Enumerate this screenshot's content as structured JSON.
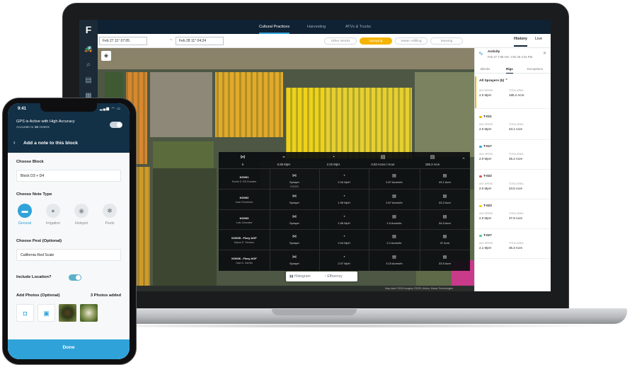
{
  "app": {
    "logo": "F",
    "tabs": [
      "Cultural Practices",
      "Harvesting",
      "ATVs & Trucks"
    ],
    "date_from": "Feb 27 11° 07:05",
    "date_to": "Feb 28 11° 04:24",
    "date_sep": "~",
    "filters": [
      "Other Works",
      "Spraying",
      "Water refilling",
      "Mowing"
    ],
    "view_tabs": [
      "History",
      "Live"
    ],
    "attribution": "Map data ©2023 Imagery ©2023, Airbus, Maxar Technologies",
    "chart_toggle": [
      "Histogram",
      "Efficiency"
    ]
  },
  "stats": {
    "summary": [
      "6",
      "5.85 MpH",
      "2.02 MpH",
      "0.83 Acres / Hour",
      "185.2 Acre"
    ],
    "rows": [
      {
        "name": "KG001",
        "owner": "Evelia S. RD Rosales",
        "equip": "Sprayer",
        "equip_id": "KG024",
        "speed": "2.04 MpH",
        "rate": "2.67 Acres/hr",
        "area": "43.1 Acre"
      },
      {
        "name": "KG002",
        "owner": "Juan Escobedo",
        "equip": "Sprayer",
        "equip_id": "",
        "speed": "1.96 MpH",
        "rate": "2.67 Acres/hr",
        "area": "33.2 Acre"
      },
      {
        "name": "KG003",
        "owner": "Luis Gonzalez",
        "equip": "Sprayer",
        "equip_id": "",
        "speed": "1.56 MpH",
        "rate": "1.5 Acres/hr",
        "area": "34.5 Acre"
      },
      {
        "name": "KG005 - Flory AOF",
        "owner": "Mauro E. Serrano",
        "equip": "Sprayer",
        "equip_id": "",
        "speed": "2.04 MpH",
        "rate": "2.2 Acres/hr",
        "area": "37 Acre"
      },
      {
        "name": "KG006 - Flory AOF",
        "owner": "Jose A. Carrillo",
        "equip": "Sprayer",
        "equip_id": "",
        "speed": "2.07 MpH",
        "rate": "3.15 Acres/hr",
        "area": "33.5 Acre"
      }
    ]
  },
  "panel": {
    "title": "Activity",
    "subtitle": "Feb 27 7:05 AM - Feb 28 4:24 PM",
    "tabs": [
      "Blocks",
      "Rigs",
      "Exceptions"
    ],
    "all_label": "All Sprayers (5)",
    "avg_label": "AVG SPEED",
    "total_label": "TOTAL AREA",
    "all_speed": "2.0 MpH",
    "all_area": "185.2 Acre",
    "rigs": [
      {
        "name": "T-011",
        "color": "#f5b400",
        "speed": "2.0 MpH",
        "area": "43.1 Acre"
      },
      {
        "name": "T-017",
        "color": "#2fa3d9",
        "speed": "2.0 MpH",
        "area": "35.2 Acre"
      },
      {
        "name": "T-022",
        "color": "#e05050",
        "speed": "2.0 MpH",
        "area": "34.5 Acre"
      },
      {
        "name": "T-023",
        "color": "#f5d000",
        "speed": "2.0 MpH",
        "area": "37.8 Acre"
      },
      {
        "name": "T-027",
        "color": "#4bc0a0",
        "speed": "2.1 MpH",
        "area": "35.3 Acre"
      }
    ]
  },
  "phone": {
    "time": "9:41",
    "status_icons": "▂▄▆ ◠ ▭",
    "gps_title": "GPS is Active with High Accuracy",
    "gps_sub_pre": "Accurate to ",
    "gps_sub_num": "16",
    "gps_sub_post": " meters",
    "nav_title": "Add a note to this block",
    "choose_block_label": "Choose Block",
    "choose_block_value": "Block D3 + D4",
    "note_type_label": "Choose Note Type",
    "note_types": [
      {
        "label": "General",
        "icon": "💬"
      },
      {
        "label": "Irrigation",
        "icon": "💧"
      },
      {
        "label": "Hotspot",
        "icon": "◉"
      },
      {
        "label": "Pests",
        "icon": "🕷"
      }
    ],
    "pest_label": "Choose Pest (Optional)",
    "pest_value": "California Red Scale",
    "location_label": "Include Location?",
    "photos_label": "Add Photos (Optional)",
    "photos_count": "3 Photos added",
    "done_label": "Done"
  }
}
